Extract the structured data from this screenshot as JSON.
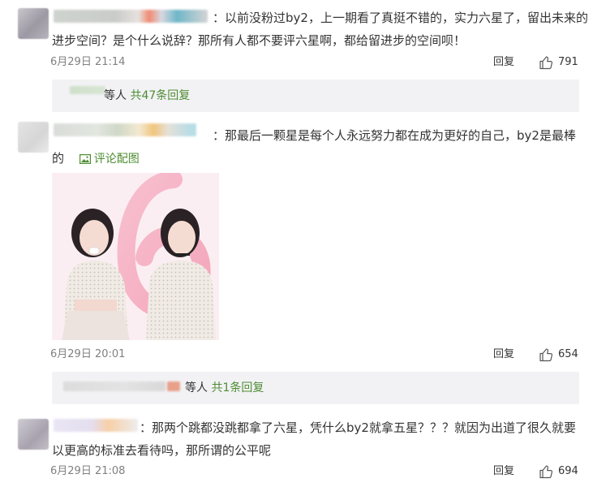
{
  "colors": {
    "link_green": "#4e8c31",
    "meta_gray": "#808080",
    "reply_bar_bg": "#f2f2f5"
  },
  "comments": [
    {
      "text_line1": "：以前没粉过by2，上一期看了真挺不错的，实力六星了，留出未来的",
      "text_line2": "进步空间？是个什么说辞？那所有人都不要评六星啊，都给留进步的空间呗！",
      "time": "6月29日 21:14",
      "reply_label": "回复",
      "like_icon": "thumbs-up-icon",
      "likes": "791",
      "replies": {
        "suffix": "等人",
        "count_label": "共47条回复"
      }
    },
    {
      "text_line1": "：那最后一颗星是每个人永远努力都在成为更好的自己，by2是最棒",
      "text_line2": "的",
      "image_link_label": "评论配图",
      "image_icon": "picture-icon",
      "time": "6月29日 20:01",
      "reply_label": "回复",
      "like_icon": "thumbs-up-icon",
      "likes": "654",
      "replies": {
        "suffix": "等人",
        "count_label": "共1条回复"
      }
    },
    {
      "text_line1": "：那两个跳都没跳都拿了六星，凭什么by2就拿五星？？？就因为出道了很久就要",
      "text_line2": "以更高的标准去看待吗，那所谓的公平呢",
      "time": "6月29日 21:08",
      "reply_label": "回复",
      "like_icon": "thumbs-up-icon",
      "likes": "694"
    }
  ]
}
